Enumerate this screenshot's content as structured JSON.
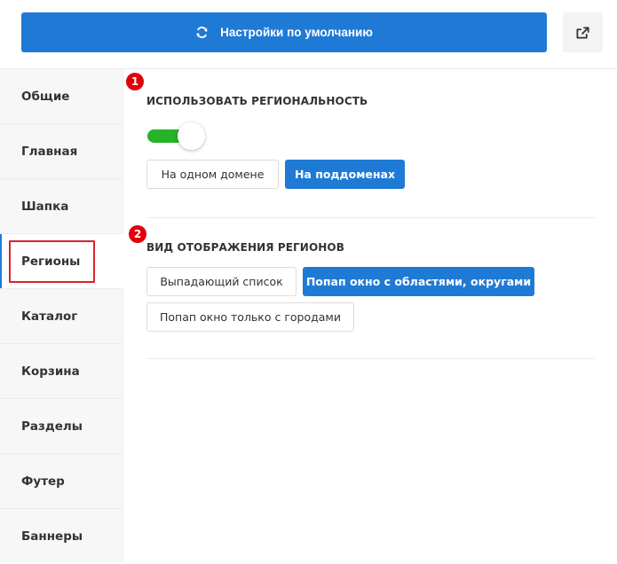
{
  "header": {
    "reset_label": "Настройки по умолчанию",
    "reset_icon": "refresh-icon",
    "share_icon": "share-icon"
  },
  "sidebar": {
    "items": [
      {
        "label": "Общие"
      },
      {
        "label": "Главная"
      },
      {
        "label": "Шапка"
      },
      {
        "label": "Регионы",
        "active": true
      },
      {
        "label": "Каталог"
      },
      {
        "label": "Корзина"
      },
      {
        "label": "Разделы"
      },
      {
        "label": "Футер"
      },
      {
        "label": "Баннеры"
      }
    ]
  },
  "main": {
    "section1": {
      "badge": "1",
      "title": "ИСПОЛЬЗОВАТЬ РЕГИОНАЛЬНОСТЬ",
      "toggle_on": true,
      "options": [
        {
          "label": "На одном домене",
          "selected": false
        },
        {
          "label": "На поддоменах",
          "selected": true
        }
      ]
    },
    "section2": {
      "badge": "2",
      "title": "ВИД ОТОБРАЖЕНИЯ РЕГИОНОВ",
      "options": [
        {
          "label": "Выпадающий список",
          "selected": false
        },
        {
          "label": "Попап окно с областями, округами",
          "selected": true
        },
        {
          "label": "Попап окно только с городами",
          "selected": false
        }
      ]
    }
  },
  "colors": {
    "accent": "#1f7ad6",
    "toggle_on": "#27b227",
    "badge": "#e0000b",
    "highlight": "#d9232d"
  }
}
